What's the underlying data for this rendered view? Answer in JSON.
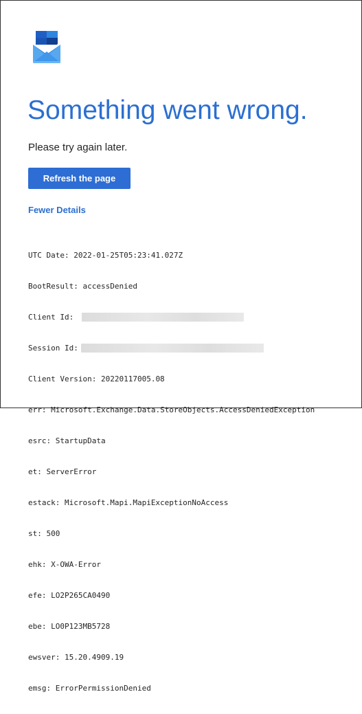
{
  "logo": {
    "icon": "outlook-envelope-icon",
    "colors": {
      "primary": "#1f5fc4",
      "light": "#5aa6ee",
      "mid": "#2d86e0",
      "dark": "#123f8f"
    }
  },
  "error": {
    "title": "Something went wrong.",
    "message": "Please try again later.",
    "refresh_label": "Refresh the page",
    "details_toggle_label": "Fewer Details"
  },
  "details": [
    {
      "label": "UTC Date:",
      "value": "2022-01-25T05:23:41.027Z"
    },
    {
      "label": "BootResult:",
      "value": "accessDenied"
    },
    {
      "label": "Client Id:",
      "value": ""
    },
    {
      "label": "Session Id:",
      "value": ""
    },
    {
      "label": "Client Version:",
      "value": "20220117005.08"
    },
    {
      "label": "err:",
      "value": "Microsoft.Exchange.Data.StoreObjects.AccessDeniedException"
    },
    {
      "label": "esrc:",
      "value": "StartupData"
    },
    {
      "label": "et:",
      "value": "ServerError"
    },
    {
      "label": "estack:",
      "value": "Microsoft.Mapi.MapiExceptionNoAccess"
    },
    {
      "label": "st:",
      "value": "500"
    },
    {
      "label": "ehk:",
      "value": "X-OWA-Error"
    },
    {
      "label": "efe:",
      "value": "LO2P265CA0490"
    },
    {
      "label": "ebe:",
      "value": "LO0P123MB5728"
    },
    {
      "label": "ewsver:",
      "value": "15.20.4909.19"
    },
    {
      "label": "emsg:",
      "value": "ErrorPermissionDenied"
    }
  ],
  "colors": {
    "accent": "#2b6fd1",
    "button": "#2e6dd3",
    "text": "#242424"
  }
}
